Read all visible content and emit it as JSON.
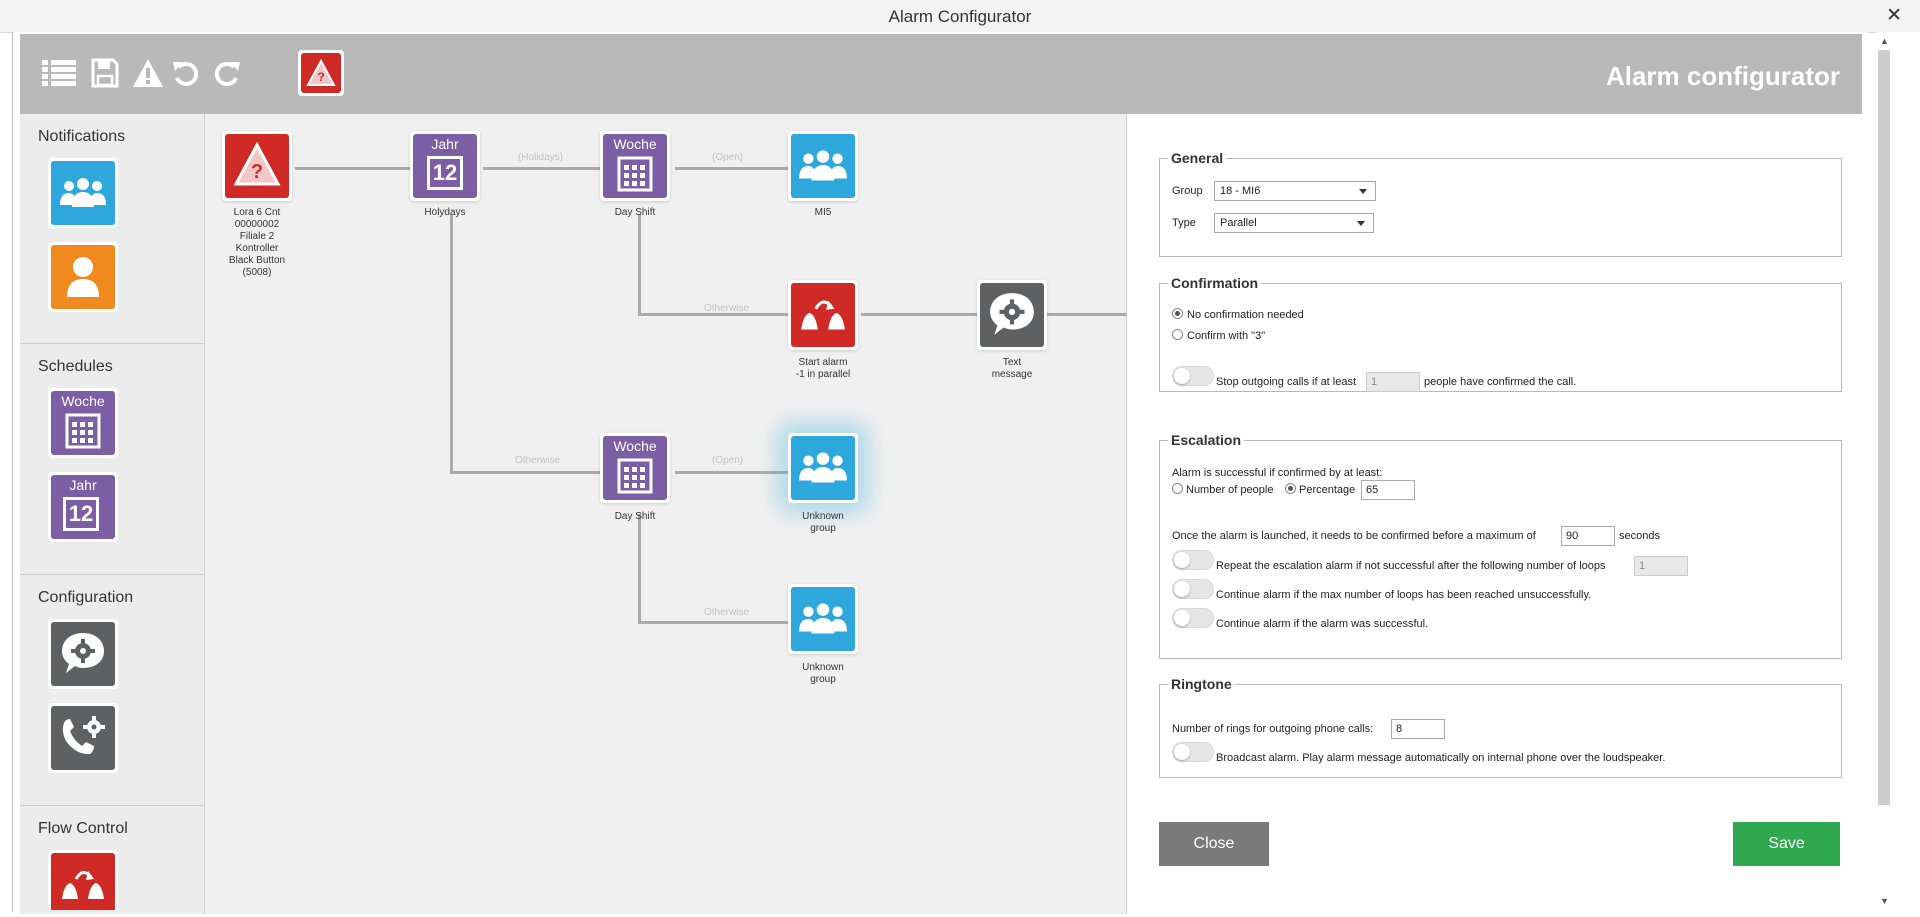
{
  "window": {
    "title": "Alarm Configurator",
    "close_glyph": "✕"
  },
  "toolbar": {
    "title": "Alarm configurator",
    "icons": [
      "list-icon",
      "save-icon",
      "warning-icon",
      "undo-icon",
      "redo-icon",
      "alarm-trigger-icon"
    ]
  },
  "sidebar": {
    "sections": [
      {
        "title": "Notifications",
        "tiles": [
          "group-icon",
          "person-icon"
        ]
      },
      {
        "title": "Schedules",
        "tiles": [
          "week-calendar-icon",
          "year-calendar-icon"
        ]
      },
      {
        "title": "Configuration",
        "tiles": [
          "message-gear-icon",
          "phone-gear-icon"
        ]
      },
      {
        "title": "Flow Control",
        "tiles": [
          "start-alarm-icon"
        ]
      }
    ],
    "week_label": "Woche",
    "year_label": "Jahr",
    "year_number": "12"
  },
  "flow": {
    "nodes": {
      "trigger": {
        "label": "Lora 6 Cnt\n00000002\nFiliale 2\nKontroller\nBlack Button\n(5008)"
      },
      "holidays": {
        "header": "Jahr",
        "number": "12",
        "label": "Holydays"
      },
      "dayshift1": {
        "header": "Woche",
        "label": "Day Shift"
      },
      "mi5": {
        "label": "MI5"
      },
      "start_alarm": {
        "label": "Start alarm\n-1 in parallel"
      },
      "text_message": {
        "label": "Text\nmessage"
      },
      "dayshift2": {
        "header": "Woche",
        "label": "Day Shift"
      },
      "unknown1": {
        "label": "Unknown\ngroup"
      },
      "unknown2": {
        "label": "Unknown\ngroup"
      }
    },
    "edge_labels": {
      "holidays": "(Holidays)",
      "open1": "(Open)",
      "otherwise1": "Otherwise",
      "otherwise2": "Otherwise",
      "open2": "(Open)",
      "otherwise3": "Otherwise"
    }
  },
  "panel": {
    "general": {
      "legend": "General",
      "group_label": "Group",
      "group_value": "18 - MI6",
      "type_label": "Type",
      "type_value": "Parallel"
    },
    "confirmation": {
      "legend": "Confirmation",
      "option1": "No confirmation needed",
      "option2": "Confirm with \"3\"",
      "selected": "No confirmation needed",
      "stop_label_a": "Stop outgoing calls if at least",
      "stop_value": "1",
      "stop_label_b": "people have confirmed the call."
    },
    "escalation": {
      "legend": "Escalation",
      "success_label": "Alarm is successful if confirmed by at least:",
      "opt_number": "Number of people",
      "opt_percentage": "Percentage",
      "selected": "Percentage",
      "percentage_value": "65",
      "max_label_a": "Once the alarm is launched, it needs to be confirmed before a maximum of",
      "max_value": "90",
      "max_label_b": "seconds",
      "repeat_label": "Repeat the escalation alarm if not successful after the following number of loops",
      "repeat_value": "1",
      "continue_max_label": "Continue alarm if the max number of loops has been reached unsuccessfully.",
      "continue_success_label": "Continue alarm if the alarm was successful."
    },
    "ringtone": {
      "legend": "Ringtone",
      "rings_label": "Number of rings for outgoing phone calls:",
      "rings_value": "8",
      "broadcast_label": "Broadcast alarm. Play alarm message automatically on internal phone over the loudspeaker."
    },
    "buttons": {
      "close": "Close",
      "save": "Save"
    }
  },
  "colors": {
    "red": "#d02a26",
    "purple": "#7b5ea4",
    "blue": "#2ea8dc",
    "orange": "#f08a1f",
    "gray": "#5e6062",
    "save_green": "#2fa84f",
    "close_gray": "#7a7a7a",
    "toolbar": "#b9b9b9"
  }
}
